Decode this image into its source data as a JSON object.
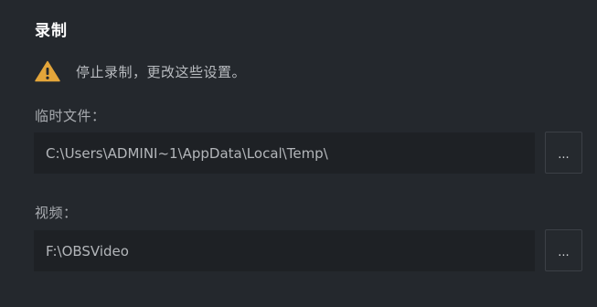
{
  "section": {
    "title": "录制"
  },
  "warning": {
    "icon": "warning-icon",
    "text": "停止录制，更改这些设置。",
    "color": "#e3a53a"
  },
  "fields": {
    "temp": {
      "label": "临时文件：",
      "value": "C:\\Users\\ADMINI~1\\AppData\\Local\\Temp\\",
      "browse_label": "..."
    },
    "video": {
      "label": "视频：",
      "value": "F:\\OBSVideo",
      "browse_label": "..."
    }
  }
}
